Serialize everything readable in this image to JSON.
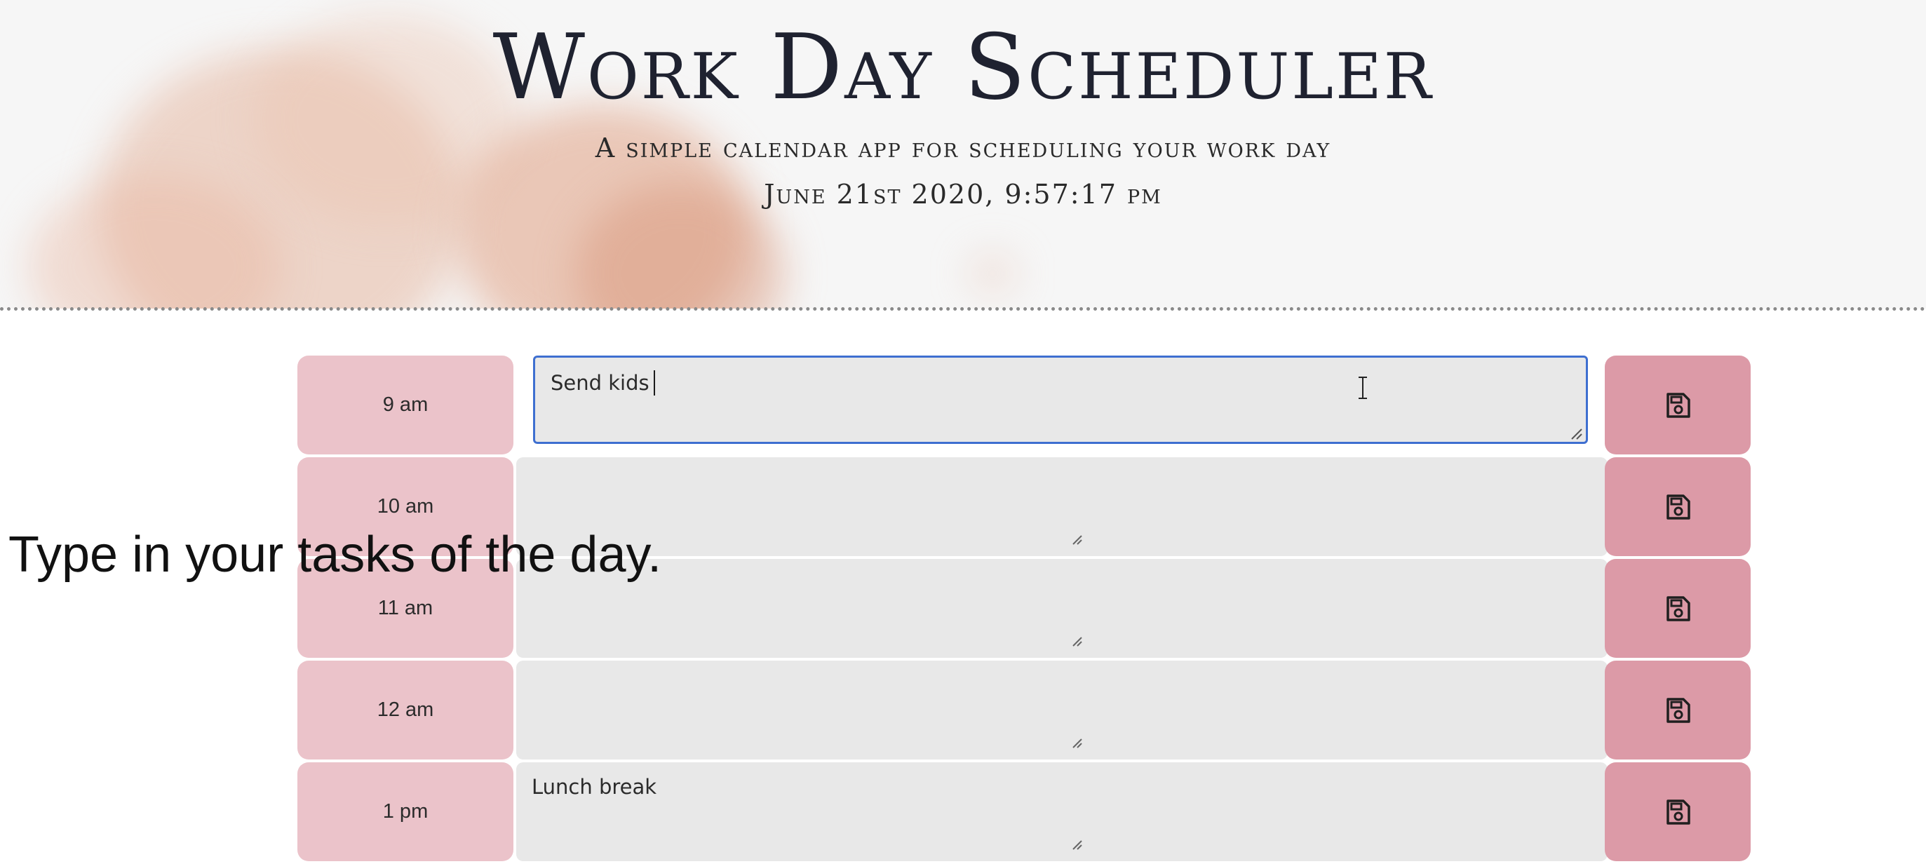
{
  "header": {
    "title": "Work Day Scheduler",
    "subtitle": "A simple calendar app for scheduling your work day",
    "datetime": "June 21st 2020, 9:57:17 pm"
  },
  "rows": [
    {
      "hour": "9 am",
      "task": "Send kids",
      "focused": true
    },
    {
      "hour": "10 am",
      "task": ""
    },
    {
      "hour": "11 am",
      "task": ""
    },
    {
      "hour": "12 am",
      "task": ""
    },
    {
      "hour": "1 pm",
      "task": "Lunch break"
    }
  ],
  "overlay_caption": "Type in your tasks of the day.",
  "icons": {
    "save": "floppy-disk-icon",
    "resize": "resize-grip-icon",
    "cursor": "text-cursor-icon"
  },
  "colors": {
    "hour_bg": "#ebc3ca",
    "save_bg": "#dc9aa7",
    "textarea_bg": "#e8e8e8",
    "focus_border": "#3e6fd0",
    "header_bg": "#f6f6f6"
  }
}
